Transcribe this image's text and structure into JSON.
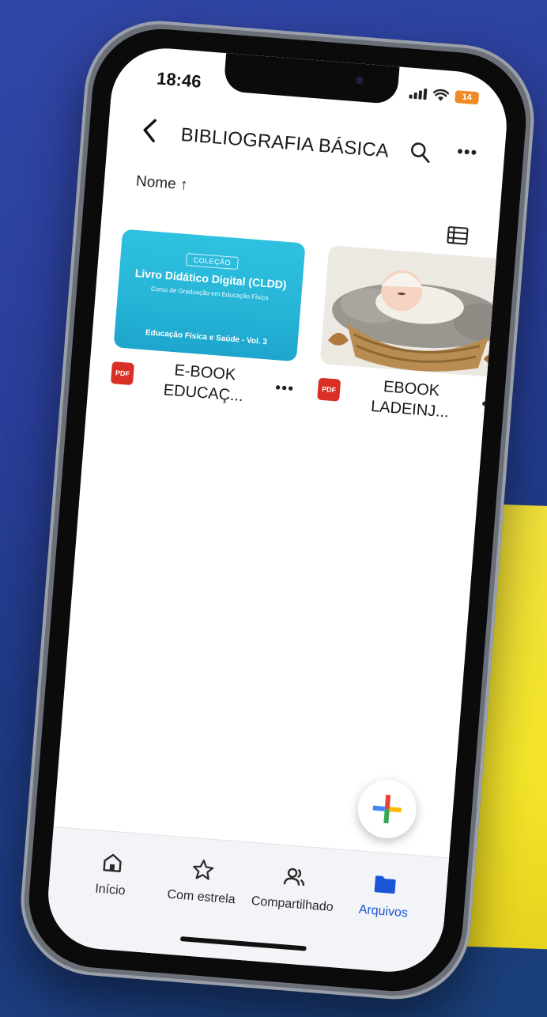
{
  "status": {
    "time": "18:46",
    "battery": "14"
  },
  "header": {
    "title": "BIBLIOGRAFIA BÁSICA",
    "back_icon": "chevron-left-icon",
    "search_icon": "search-icon",
    "more_icon": "more-horizontal-icon"
  },
  "sort": {
    "label": "Nome",
    "direction_icon": "arrow-up-icon"
  },
  "files": [
    {
      "name_line1": "E-BOOK",
      "name_line2": "EDUCAÇ...",
      "type": "PDF",
      "thumb": {
        "tag": "COLEÇÃO",
        "title": "Livro Didático Digital (CLDD)",
        "subtitle": "Curso de Graduação em Educação Física",
        "volume": "Educação Física e Saúde - Vol. 3"
      }
    },
    {
      "name_line1": "EBOOK",
      "name_line2": "LADEINJ...",
      "type": "PDF"
    }
  ],
  "nav": {
    "items": [
      {
        "label": "Início",
        "icon": "home-icon"
      },
      {
        "label": "Com estrela",
        "icon": "star-icon"
      },
      {
        "label": "Compartilhado",
        "icon": "shared-users-icon"
      },
      {
        "label": "Arquivos",
        "icon": "folder-icon"
      }
    ]
  },
  "colors": {
    "accent": "#1a56d6",
    "pdf": "#d93025",
    "battery": "#f08a24"
  }
}
